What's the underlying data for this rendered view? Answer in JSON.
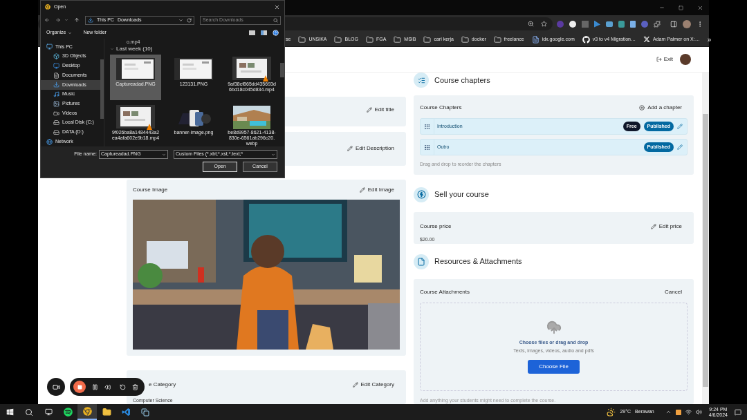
{
  "bookmarks": [
    {
      "label": "se",
      "kind": "cut"
    },
    {
      "label": "UNSIKA",
      "kind": "folder"
    },
    {
      "label": "BLOG",
      "kind": "folder"
    },
    {
      "label": "FGA",
      "kind": "folder"
    },
    {
      "label": "MSIB",
      "kind": "folder"
    },
    {
      "label": "cari kerja",
      "kind": "folder"
    },
    {
      "label": "docker",
      "kind": "folder"
    },
    {
      "label": "freelance",
      "kind": "folder"
    },
    {
      "label": "idx.google.com",
      "kind": "page"
    },
    {
      "label": "v3 to v4 Migration…",
      "kind": "github"
    },
    {
      "label": "Adam Palmer on X:…",
      "kind": "x"
    }
  ],
  "bookmarks_more": "»",
  "header": {
    "exit": "Exit"
  },
  "left_cards": {
    "title_action": "Edit title",
    "description_action": "Edit Description",
    "image": {
      "title": "Course Image",
      "action": "Edit Image"
    },
    "category": {
      "title": "e Category",
      "action": "Edit Category",
      "value": "Computer Science"
    }
  },
  "chapters": {
    "heading": "Course chapters",
    "card_title": "Course Chapters",
    "add": "Add a chapter",
    "items": [
      {
        "title": "Introduction",
        "badges": [
          {
            "label": "Free",
            "kind": "free"
          },
          {
            "label": "Published",
            "kind": "published"
          }
        ]
      },
      {
        "title": "Outro",
        "badges": [
          {
            "label": "Published",
            "kind": "published"
          }
        ]
      }
    ],
    "hint": "Drag and drop to reorder the chapters"
  },
  "price": {
    "heading": "Sell your course",
    "card_title": "Course price",
    "action": "Edit price",
    "value": "$20.00"
  },
  "resources": {
    "heading": "Resources & Attachments",
    "card_title": "Course Attachments",
    "action": "Cancel",
    "drop_title": "Choose files or drag and drop",
    "drop_hint": "Texts, images, videos, audio and pdfs",
    "button": "Choose File",
    "note": "Add anything your students might need to complete the course."
  },
  "dialog": {
    "title": "Open",
    "path": [
      "This PC",
      "Downloads"
    ],
    "search_placeholder": "Search Downloads",
    "toolbar": [
      "Organize",
      "New folder"
    ],
    "nav": [
      {
        "label": "This PC",
        "kind": "pc",
        "selected": false,
        "children": [
          {
            "label": "3D Objects",
            "kind": "objects",
            "selected": false
          },
          {
            "label": "Desktop",
            "kind": "desktop",
            "selected": false
          },
          {
            "label": "Documents",
            "kind": "documents",
            "selected": false
          },
          {
            "label": "Downloads",
            "kind": "downloads",
            "selected": true
          },
          {
            "label": "Music",
            "kind": "music",
            "selected": false
          },
          {
            "label": "Pictures",
            "kind": "pictures",
            "selected": false
          },
          {
            "label": "Videos",
            "kind": "videos",
            "selected": false
          },
          {
            "label": "Local Disk (C:)",
            "kind": "disk",
            "selected": false
          },
          {
            "label": "DATA (D:)",
            "kind": "disk",
            "selected": false
          }
        ]
      },
      {
        "label": "Network",
        "kind": "network",
        "selected": false
      }
    ],
    "top_cut": "o.mp4",
    "group": "Last week (10)",
    "files": [
      {
        "name": "Captureadad.PNG",
        "kind": "screenshot",
        "selected": true
      },
      {
        "name": "123131.PNG",
        "kind": "screenshot",
        "selected": false
      },
      {
        "name": "9af38cf865dd435693d6bd18c045d834.mp4",
        "kind": "video",
        "selected": false
      },
      {
        "name": "9f026ba8a1484443a2ea4afa602e9b18.mp4",
        "kind": "video",
        "selected": false
      },
      {
        "name": "banner-image.png",
        "kind": "devices",
        "selected": false
      },
      {
        "name": "be8d9957-8621-4138-830e-6561ab296c20.webp",
        "kind": "picture",
        "selected": false
      }
    ],
    "file_name_label": "File name:",
    "file_name": "Captureadad.PNG",
    "filter": "Custom Files (*.xbt;*.xst;*.text;*",
    "buttons": [
      "Open",
      "Cancel"
    ]
  },
  "taskbar": {
    "apps": [
      {
        "kind": "spotify",
        "selected": false
      },
      {
        "kind": "chrome",
        "selected": true
      },
      {
        "kind": "files",
        "selected": false
      },
      {
        "kind": "vscode",
        "selected": false
      },
      {
        "kind": "notes",
        "selected": false
      }
    ],
    "temperature": "29°C",
    "weather": "Berawan",
    "time": "9:24 PM",
    "date": "4/6/2024"
  }
}
